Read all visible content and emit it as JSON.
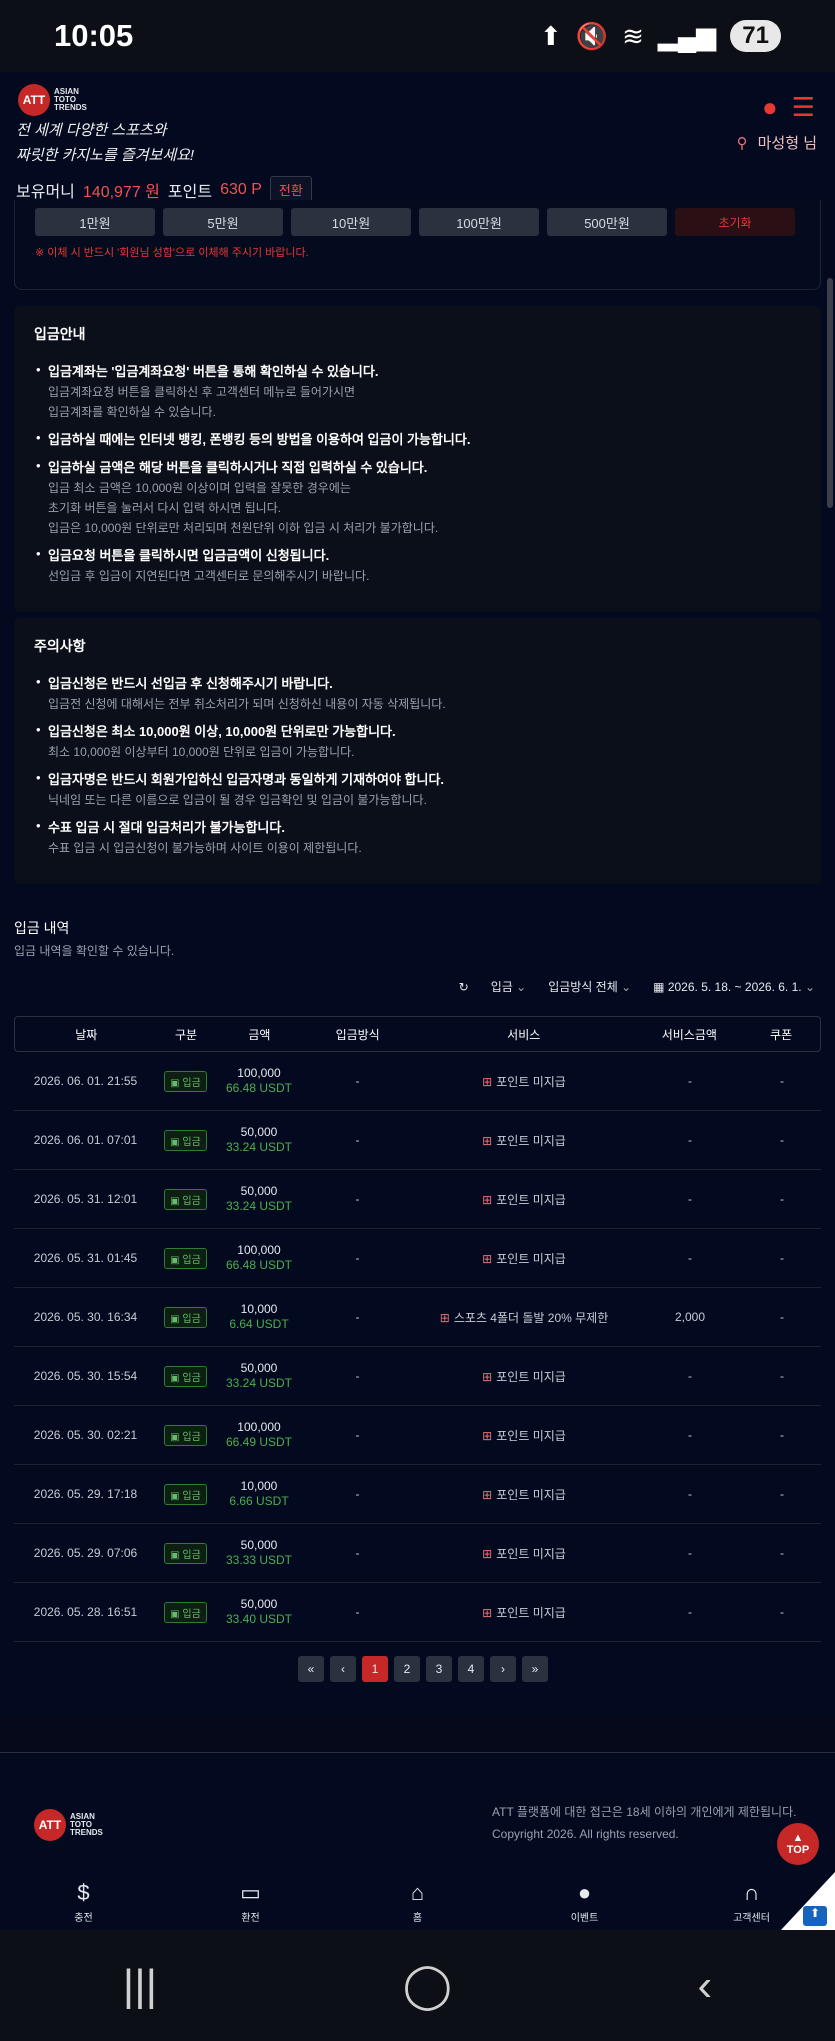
{
  "status_bar": {
    "time": "10:05",
    "battery": "71",
    "icons": [
      "upload-icon",
      "mute-icon",
      "wifi-icon",
      "signal-icon"
    ]
  },
  "header": {
    "logo_text": "ATT",
    "logo_lines": [
      "ASIAN",
      "TOTO",
      "TRENDS"
    ],
    "tagline_1": "전 세계 다양한 스포츠와",
    "tagline_2": "짜릿한 카지노를 즐겨보세요!",
    "user_name": "마성형 님",
    "balance_label": "보유머니",
    "balance_value": "140,977 원",
    "point_label": "포인트",
    "point_value": "630 P",
    "convert_label": "전환"
  },
  "amount_buttons": [
    "1만원",
    "5만원",
    "10만원",
    "100만원",
    "500만원"
  ],
  "amount_reset": "초기화",
  "amount_note": "※ 이체 시 반드시 '회원님 성함'으로 이체해 주시기 바랍니다.",
  "deposit_info": {
    "title": "입금안내",
    "items": [
      {
        "head": "입금계좌는 '입금계좌요청' 버튼을 통해 확인하실 수 있습니다.",
        "sub": [
          "입금계좌요청 버튼을 클릭하신 후 고객센터 메뉴로 들어가시면",
          "입금계좌를 확인하실 수 있습니다."
        ]
      },
      {
        "head": "입금하실 때에는 인터넷 뱅킹, 폰뱅킹 등의 방법을 이용하여 입금이 가능합니다.",
        "sub": []
      },
      {
        "head": "입금하실 금액은 해당 버튼을 클릭하시거나 직접 입력하실 수 있습니다.",
        "sub": [
          "입금 최소 금액은 10,000원 이상이며 입력을 잘못한 경우에는",
          "초기화 버튼을 눌러서 다시 입력 하시면 됩니다.",
          "입금은 10,000원 단위로만 처리되며 천원단위 이하 입금 시 처리가 불가합니다."
        ]
      },
      {
        "head": "입금요청 버튼을 클릭하시면 입금금액이 신청됩니다.",
        "sub": [
          "선입금 후 입금이 지연된다면 고객센터로 문의해주시기 바랍니다."
        ]
      }
    ]
  },
  "caution": {
    "title": "주의사항",
    "items": [
      {
        "head": "입금신청은 반드시 선입금 후 신청해주시기 바랍니다.",
        "sub": [
          "입금전 신청에 대해서는 전부 취소처리가 되며 신청하신 내용이 자동 삭제됩니다."
        ]
      },
      {
        "head": "입금신청은 최소 10,000원 이상, 10,000원 단위로만 가능합니다.",
        "sub": [
          "최소 10,000원 이상부터 10,000원 단위로 입금이 가능합니다."
        ]
      },
      {
        "head": "입금자명은 반드시 회원가입하신 입금자명과 동일하게 기재하여야 합니다.",
        "sub": [
          "닉네임 또는 다른 이름으로 입금이 될 경우 입금확인 및 입금이 불가능합니다."
        ]
      },
      {
        "head": "수표 입금 시 절대 입금처리가 불가능합니다.",
        "sub": [
          "수표 입금 시 입금신청이 불가능하며 사이트 이용이 제한됩니다."
        ]
      }
    ]
  },
  "history": {
    "title": "입금 내역",
    "subtitle": "입금 내역을 확인할 수 있습니다.",
    "filter_type": "입금",
    "filter_method": "입금방식 전체",
    "filter_dates": "2026. 5. 18. ~ 2026. 6. 1.",
    "columns": [
      "날짜",
      "구분",
      "금액",
      "입금방식",
      "서비스",
      "서비스금액",
      "쿠폰"
    ],
    "rows": [
      {
        "date": "2026. 06. 01. 21:55",
        "type": "입금",
        "amount": "100,000",
        "usdt": "66.48 USDT",
        "method": "-",
        "service": "포인트 미지급",
        "service_amount": "-",
        "coupon": "-"
      },
      {
        "date": "2026. 06. 01. 07:01",
        "type": "입금",
        "amount": "50,000",
        "usdt": "33.24 USDT",
        "method": "-",
        "service": "포인트 미지급",
        "service_amount": "-",
        "coupon": "-"
      },
      {
        "date": "2026. 05. 31. 12:01",
        "type": "입금",
        "amount": "50,000",
        "usdt": "33.24 USDT",
        "method": "-",
        "service": "포인트 미지급",
        "service_amount": "-",
        "coupon": "-"
      },
      {
        "date": "2026. 05. 31. 01:45",
        "type": "입금",
        "amount": "100,000",
        "usdt": "66.48 USDT",
        "method": "-",
        "service": "포인트 미지급",
        "service_amount": "-",
        "coupon": "-"
      },
      {
        "date": "2026. 05. 30. 16:34",
        "type": "입금",
        "amount": "10,000",
        "usdt": "6.64 USDT",
        "method": "-",
        "service": "스포츠 4폴더 돌발 20% 무제한",
        "service_amount": "2,000",
        "coupon": "-"
      },
      {
        "date": "2026. 05. 30. 15:54",
        "type": "입금",
        "amount": "50,000",
        "usdt": "33.24 USDT",
        "method": "-",
        "service": "포인트 미지급",
        "service_amount": "-",
        "coupon": "-"
      },
      {
        "date": "2026. 05. 30. 02:21",
        "type": "입금",
        "amount": "100,000",
        "usdt": "66.49 USDT",
        "method": "-",
        "service": "포인트 미지급",
        "service_amount": "-",
        "coupon": "-"
      },
      {
        "date": "2026. 05. 29. 17:18",
        "type": "입금",
        "amount": "10,000",
        "usdt": "6.66 USDT",
        "method": "-",
        "service": "포인트 미지급",
        "service_amount": "-",
        "coupon": "-"
      },
      {
        "date": "2026. 05. 29. 07:06",
        "type": "입금",
        "amount": "50,000",
        "usdt": "33.33 USDT",
        "method": "-",
        "service": "포인트 미지급",
        "service_amount": "-",
        "coupon": "-"
      },
      {
        "date": "2026. 05. 28. 16:51",
        "type": "입금",
        "amount": "50,000",
        "usdt": "33.40 USDT",
        "method": "-",
        "service": "포인트 미지급",
        "service_amount": "-",
        "coupon": "-"
      }
    ]
  },
  "pagination": {
    "first": "«",
    "prev": "‹",
    "pages": [
      "1",
      "2",
      "3",
      "4"
    ],
    "active": "1",
    "next": "›",
    "last": "»"
  },
  "footer": {
    "legal_1": "ATT 플랫폼에 대한 접근은 18세 이하의 개인에게 제한됩니다.",
    "legal_2": "Copyright 2026. All rights reserved.",
    "top_label": "TOP"
  },
  "bottom_nav": [
    {
      "label": "충전",
      "icon": "coin-icon"
    },
    {
      "label": "환전",
      "icon": "cash-icon"
    },
    {
      "label": "홈",
      "icon": "home-icon"
    },
    {
      "label": "이벤트",
      "icon": "person-icon"
    },
    {
      "label": "고객센터",
      "icon": "headset-icon"
    }
  ],
  "colors": {
    "accent": "#c62828",
    "usdt": "#4caf50",
    "background": "#030a1f"
  }
}
